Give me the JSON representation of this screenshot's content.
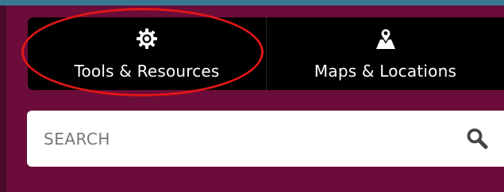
{
  "nav": {
    "items": [
      {
        "label": "Tools & Resources",
        "icon": "gear-icon",
        "highlighted": true
      },
      {
        "label": "Maps & Locations",
        "icon": "map-pin-icon"
      }
    ]
  },
  "search": {
    "placeholder": "SEARCH",
    "value": "",
    "icon": "search-icon"
  },
  "colors": {
    "background": "#6b0c3a",
    "top_bar": "#3a7792",
    "nav_background": "#000000",
    "highlight_ring": "#e01616",
    "search_background": "#ffffff"
  }
}
